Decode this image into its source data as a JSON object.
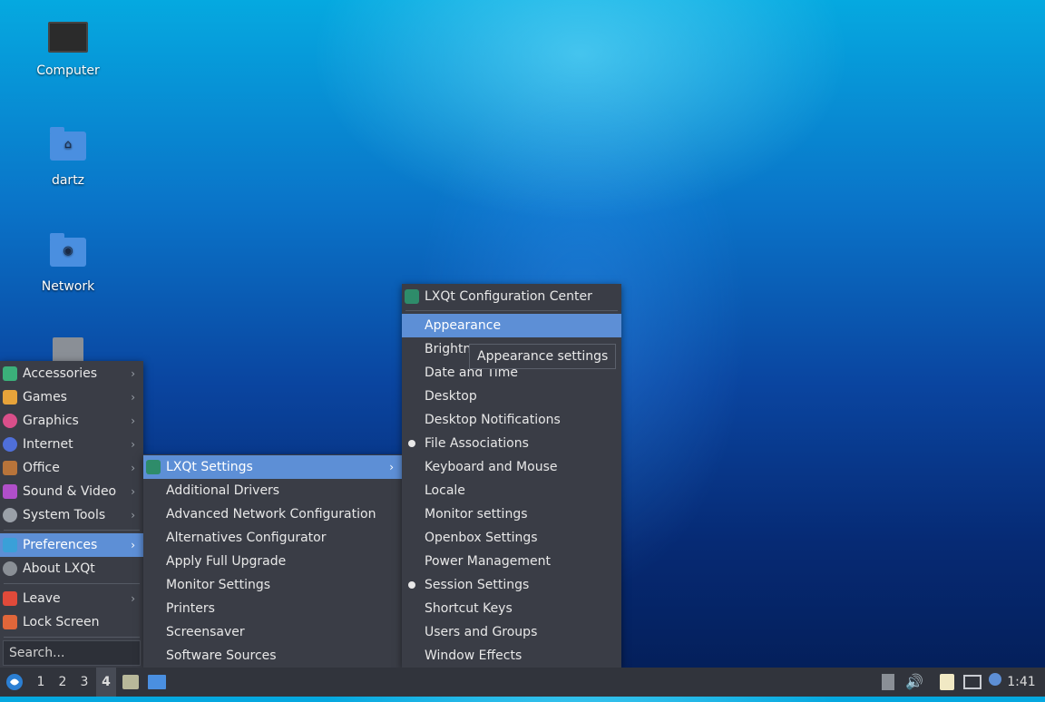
{
  "desktop": {
    "icons": [
      {
        "label": "Computer",
        "icon": "computer-icon"
      },
      {
        "label": "dartz",
        "icon": "home-folder-icon"
      },
      {
        "label": "Network",
        "icon": "network-folder-icon"
      },
      {
        "label": "",
        "icon": "trash-icon"
      }
    ]
  },
  "main_menu": {
    "categories": [
      {
        "label": "Accessories",
        "icon": "accessories-icon",
        "color": "#3bb07a"
      },
      {
        "label": "Games",
        "icon": "games-icon",
        "color": "#e7a33a"
      },
      {
        "label": "Graphics",
        "icon": "graphics-icon",
        "color": "#d94f8a"
      },
      {
        "label": "Internet",
        "icon": "internet-icon",
        "color": "#4f6fd9"
      },
      {
        "label": "Office",
        "icon": "office-icon",
        "color": "#b8743a"
      },
      {
        "label": "Sound & Video",
        "icon": "sound-video-icon",
        "color": "#b04fc9"
      },
      {
        "label": "System Tools",
        "icon": "system-tools-icon",
        "color": "#9aa0a8"
      },
      {
        "label": "Preferences",
        "icon": "preferences-icon",
        "color": "#3aa0d8"
      },
      {
        "label": "About LXQt",
        "icon": "info-icon",
        "color": "#8a8f96"
      },
      {
        "label": "Leave",
        "icon": "power-icon",
        "color": "#e04a3a"
      },
      {
        "label": "Lock Screen",
        "icon": "lock-icon",
        "color": "#e0663a"
      }
    ],
    "search_placeholder": "Search..."
  },
  "preferences_menu": {
    "items": [
      {
        "label": "LXQt Settings"
      },
      {
        "label": "Additional Drivers"
      },
      {
        "label": "Advanced Network Configuration"
      },
      {
        "label": "Alternatives Configurator"
      },
      {
        "label": "Apply Full Upgrade"
      },
      {
        "label": "Monitor Settings"
      },
      {
        "label": "Printers"
      },
      {
        "label": "Screensaver"
      },
      {
        "label": "Software Sources"
      }
    ]
  },
  "lxqt_settings_menu": {
    "header": "LXQt Configuration Center",
    "items": [
      {
        "label": "Appearance"
      },
      {
        "label": "Brightness"
      },
      {
        "label": "Date and Time"
      },
      {
        "label": "Desktop"
      },
      {
        "label": "Desktop Notifications"
      },
      {
        "label": "File Associations"
      },
      {
        "label": "Keyboard and Mouse"
      },
      {
        "label": "Locale"
      },
      {
        "label": "Monitor settings"
      },
      {
        "label": "Openbox Settings"
      },
      {
        "label": "Power Management"
      },
      {
        "label": "Session Settings"
      },
      {
        "label": "Shortcut Keys"
      },
      {
        "label": "Users and Groups"
      },
      {
        "label": "Window Effects"
      }
    ]
  },
  "tooltip": "Appearance settings",
  "taskbar": {
    "desktops": [
      "1",
      "2",
      "3",
      "4"
    ],
    "active_desktop": "4",
    "clock": "1:41"
  }
}
